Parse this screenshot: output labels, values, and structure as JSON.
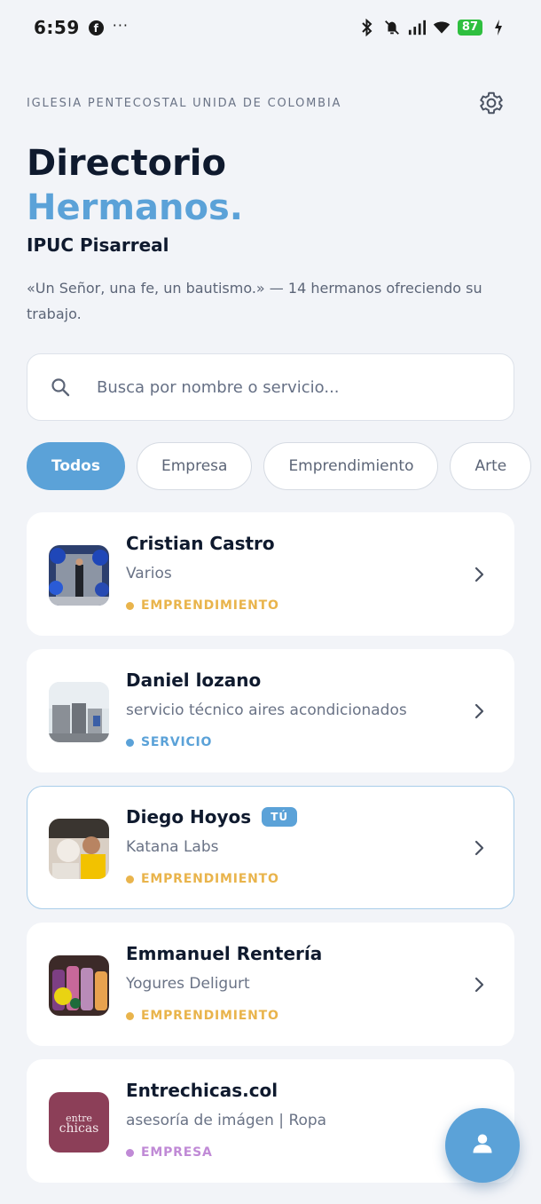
{
  "status_bar": {
    "time": "6:59",
    "dots": "···",
    "battery": "87"
  },
  "header": {
    "org": "IGLESIA PENTECOSTAL UNIDA DE COLOMBIA",
    "title": "Directorio",
    "subtitle": "Hermanos.",
    "church": "IPUC Pisarreal",
    "tagline": "«Un Señor, una fe, un bautismo.» — 14 hermanos ofreciendo su trabajo."
  },
  "search": {
    "placeholder": "Busca por nombre o servicio..."
  },
  "filters": [
    {
      "label": "Todos",
      "active": true
    },
    {
      "label": "Empresa",
      "active": false
    },
    {
      "label": "Emprendimiento",
      "active": false
    },
    {
      "label": "Arte",
      "active": false
    },
    {
      "label": "",
      "active": false
    }
  ],
  "colors": {
    "accent": "#5ba2d8",
    "emprendimiento": "#e9b44c",
    "servicio": "#5ba2d8",
    "empresa": "#c08ad6"
  },
  "members": [
    {
      "name": "Cristian Castro",
      "description": "Varios",
      "category": "EMPRENDIMIENTO",
      "badge": ""
    },
    {
      "name": "Daniel lozano",
      "description": "servicio técnico aires acondicionados",
      "category": "SERVICIO",
      "badge": ""
    },
    {
      "name": "Diego Hoyos",
      "description": "Katana Labs",
      "category": "EMPRENDIMIENTO",
      "badge": "TÚ"
    },
    {
      "name": "Emmanuel Rentería",
      "description": "Yogures Deligurt",
      "category": "EMPRENDIMIENTO",
      "badge": ""
    },
    {
      "name": "Entrechicas.col",
      "description": "asesoría de imágen | Ropa",
      "category": "EMPRESA",
      "badge": "",
      "logo_text": "entre chicas"
    }
  ]
}
